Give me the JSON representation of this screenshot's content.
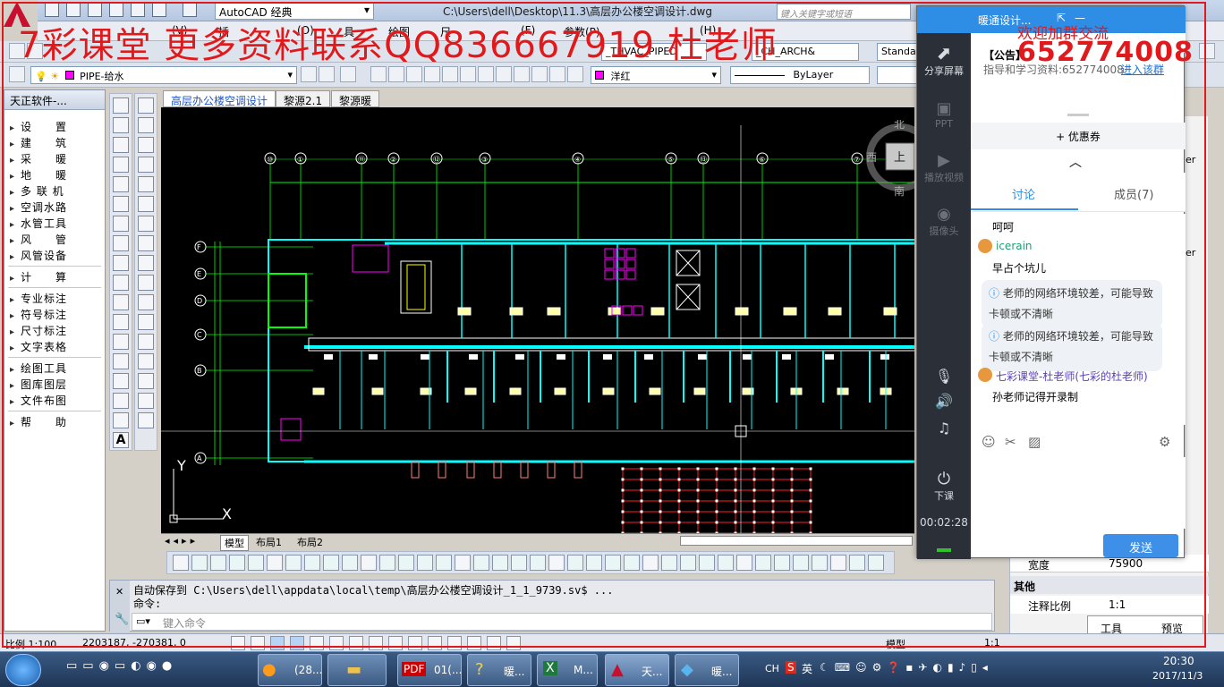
{
  "titlebar": {
    "workspace": "AutoCAD 经典",
    "file_path": "C:\\Users\\dell\\Desktop\\11.3\\高层办公楼空调设计.dwg",
    "search_placeholder": "键入关键字或短语"
  },
  "watermark": {
    "line": "7彩课堂  更多资料联系QQ836667919 杜老师",
    "group_text": "欢迎加群交流",
    "group_number": "652774008"
  },
  "menubar": {
    "items": [
      "(V)",
      "插",
      "(O)",
      "具",
      "绘图",
      "尺",
      "(F)",
      "参数(P)",
      "(H)"
    ]
  },
  "toolbar": {
    "standard_dropdown": "Standa",
    "layer_value": "PIPE-给水",
    "color_value": "洋红",
    "linetype_value": "ByLayer",
    "plot_dropdown": "_THVAC_PIPED",
    "arch_dropdown": "_CH_ARCH&"
  },
  "left_panel": {
    "title": "天正软件-...",
    "groups": [
      [
        "设　　置",
        "建　　筑",
        "采　　暖",
        "地　　暖",
        "多 联 机",
        "空调水路",
        "水管工具",
        "风　　管",
        "风管设备"
      ],
      [
        "计　　算"
      ],
      [
        "专业标注",
        "符号标注",
        "尺寸标注",
        "文字表格"
      ],
      [
        "绘图工具",
        "图库图层",
        "文件布图"
      ],
      [
        "帮　　助"
      ]
    ]
  },
  "doc_tabs": [
    "高层办公楼空调设计",
    "黎源2.1",
    "黎源暖"
  ],
  "drawing": {
    "axis_numbers": [
      "⑩",
      "①",
      "⑪",
      "②",
      "⑫",
      "③",
      "④",
      "⑤",
      "⑬",
      "⑥",
      "⑦"
    ],
    "row_letters": [
      "F",
      "E",
      "D",
      "C",
      "B",
      "A"
    ],
    "compass": {
      "north": "北",
      "south": "南",
      "west": "西",
      "center": "上"
    },
    "ucs_y": "Y",
    "ucs_x": "X"
  },
  "layout_tabs": [
    "模型",
    "布局1",
    "布局2"
  ],
  "command": {
    "line1": "自动保存到 C:\\Users\\dell\\appdata\\local\\temp\\高层办公楼空调设计_1_1_9739.sv$ ...",
    "line2": "命令:",
    "placeholder": "键入命令"
  },
  "statusbar": {
    "scale": "比例 1:100",
    "coords": "2203187,  -270381,  0",
    "model": "模型",
    "annotation_scale": "1:1"
  },
  "properties": {
    "width_label": "宽度",
    "width_value": "75900",
    "other_label": "其他",
    "anno_scale_label": "注释比例",
    "anno_scale_value": "1:1",
    "partial_labels": [
      "er",
      "er"
    ]
  },
  "tooltip": {
    "tools": "工具",
    "preview": "预览"
  },
  "qq": {
    "title": "暖通设计...",
    "announcement_label": "【公告】",
    "announcement_text": "指导和学习资料:652774008",
    "join_group": "进入该群",
    "coupon": "+ 优惠券",
    "tab_discuss": "讨论",
    "tab_members": "成员(7)",
    "side_items": [
      "分享屏幕",
      "PPT",
      "播放视频",
      "摄像头"
    ],
    "leave_label": "下课",
    "timer": "00:02:28",
    "send_button": "发送",
    "messages": [
      {
        "type": "text",
        "text": "呵呵"
      },
      {
        "type": "user",
        "text": "icerain"
      },
      {
        "type": "text",
        "text": "早占个坑儿"
      },
      {
        "type": "notice",
        "text": "老师的网络环境较差，可能导致卡顿或不清晰"
      },
      {
        "type": "notice",
        "text": "老师的网络环境较差，可能导致卡顿或不清晰"
      },
      {
        "type": "user",
        "text": "七彩课堂-杜老师(七彩的杜老师)"
      },
      {
        "type": "text",
        "text": "孙老师记得开录制"
      }
    ]
  },
  "taskbar": {
    "items": [
      "(28...",
      "",
      "01(...",
      "暖...",
      "M...",
      "天...",
      "暖..."
    ],
    "tray": {
      "ime": "CH",
      "ime_mode": "英",
      "time": "20:30",
      "date": "2017/11/3"
    }
  }
}
